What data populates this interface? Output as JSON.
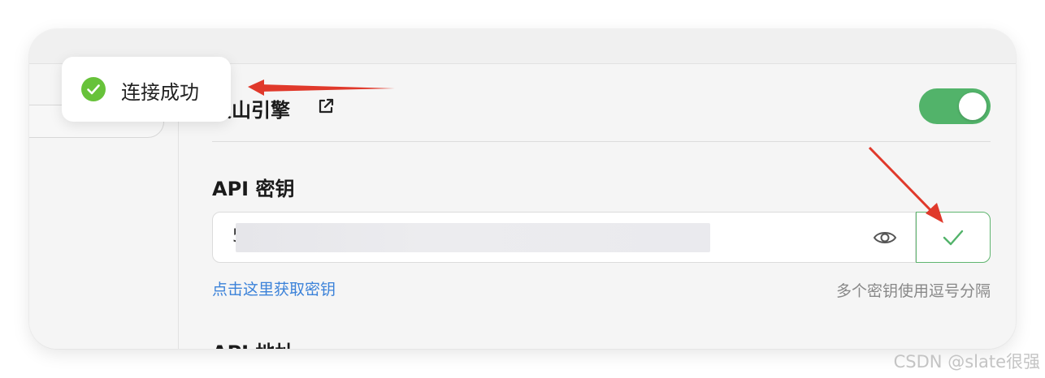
{
  "provider": {
    "name_partial": "火山引擎",
    "enabled": true
  },
  "api_key": {
    "label": "API 密钥",
    "value_visible": "5",
    "help_link": "点击这里获取密钥",
    "hint": "多个密钥使用逗号分隔"
  },
  "next_section": {
    "label": "API 地址"
  },
  "toast": {
    "message": "连接成功"
  },
  "watermark": "CSDN @slate很强",
  "colors": {
    "toggle_on": "#52b36a",
    "success": "#5fb56f",
    "link": "#3b82d9",
    "annotation_arrow": "#e0392b"
  },
  "icons": {
    "external_link": "external-link-icon",
    "eye": "eye-icon",
    "check": "check-icon",
    "toast_status": "check-circle-icon"
  }
}
